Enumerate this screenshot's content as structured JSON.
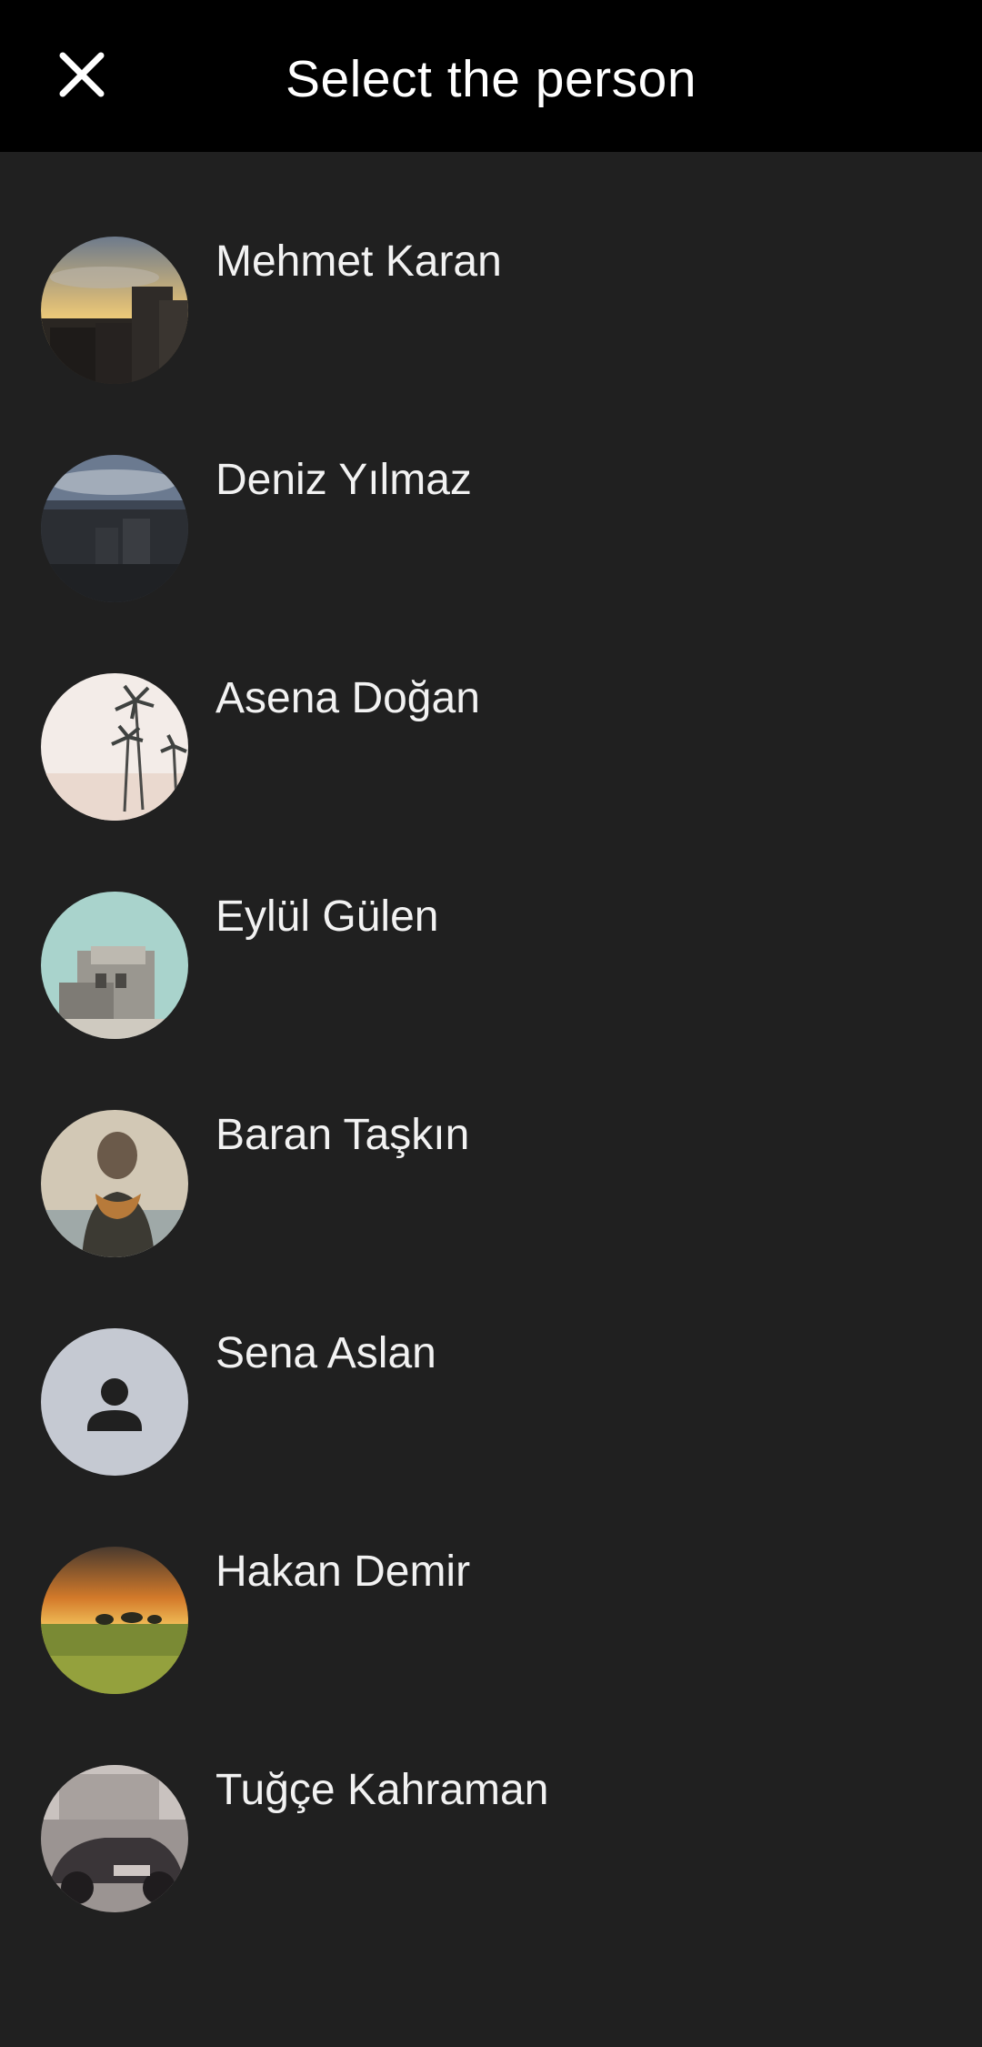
{
  "header": {
    "title": "Select the person",
    "close_icon": "close-icon"
  },
  "people": [
    {
      "name": "Mehmet Karan",
      "avatar": "photo-city-sunset"
    },
    {
      "name": "Deniz Yılmaz",
      "avatar": "photo-city-dusk"
    },
    {
      "name": "Asena Doğan",
      "avatar": "photo-palm-trees"
    },
    {
      "name": "Eylül Gülen",
      "avatar": "photo-building-sky"
    },
    {
      "name": "Baran Taşkın",
      "avatar": "photo-person-scarf"
    },
    {
      "name": "Sena Aslan",
      "avatar": "default-person-icon"
    },
    {
      "name": "Hakan Demir",
      "avatar": "photo-savanna-sunset"
    },
    {
      "name": "Tuğçe Kahraman",
      "avatar": "photo-vintage-car"
    }
  ],
  "colors": {
    "header_bg": "#000000",
    "list_bg": "#202020",
    "text": "#f2f2f2",
    "default_avatar_bg": "#c5c9d2"
  }
}
